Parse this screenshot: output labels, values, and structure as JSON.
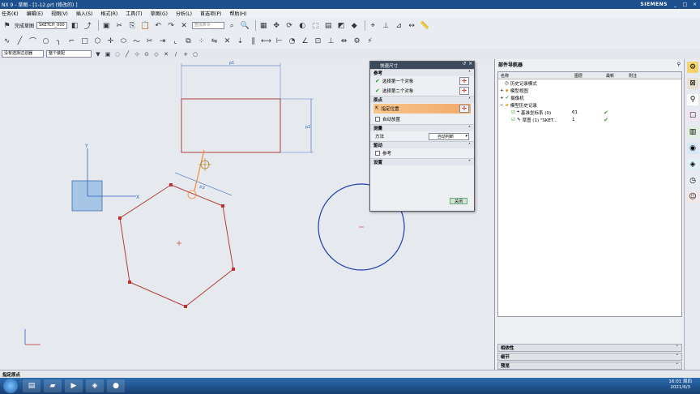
{
  "window": {
    "title": "NX 9 - 草图 - [1-12.prt (修改的) ]",
    "brand": "SIEMENS"
  },
  "menu": [
    "任务(K)",
    "编辑(E)",
    "视图(V)",
    "插入(S)",
    "格式(R)",
    "工具(T)",
    "草图(G)",
    "分析(L)",
    "首选项(P)",
    "帮助(H)"
  ],
  "toolbar": {
    "finish_sketch": "完成草图",
    "sketch_name": "SKETCH_000",
    "search_placeholder": "查找命令"
  },
  "filter": {
    "selection_filter": "没有选择过滤器",
    "scope": "整个装配"
  },
  "dialog": {
    "title": "快速尺寸",
    "sections": {
      "reference": "参考",
      "origin": "原点",
      "measure": "测量",
      "drive": "驱动",
      "settings": "设置"
    },
    "rows": {
      "first_object": "选择第一个对象",
      "second_object": "选择第二个对象",
      "specify_location": "指定位置",
      "auto_placement": "自动放置",
      "method_label": "方法",
      "method_value": "自动判断",
      "reference_chk": "参考"
    },
    "close": "关闭"
  },
  "navigator": {
    "title": "部件导航器",
    "columns": [
      "名称",
      "图层",
      "最新",
      "附注"
    ],
    "items": [
      {
        "name": "历史记录模式",
        "layer": "",
        "latest": ""
      },
      {
        "name": "模型视图",
        "layer": "",
        "latest": ""
      },
      {
        "name": "摄像机",
        "layer": "",
        "latest": ""
      },
      {
        "name": "模型历史记录",
        "layer": "",
        "latest": ""
      },
      {
        "name": "基准坐标系 (0)",
        "layer": "61",
        "latest": "✔"
      },
      {
        "name": "草图 (1) \"SKET...",
        "layer": "1",
        "latest": "✔"
      }
    ],
    "lower_panels": [
      "相依性",
      "细节",
      "预览"
    ]
  },
  "canvas": {
    "dim_labels": {
      "top": "p1",
      "right": "p2",
      "slant": "p3"
    },
    "axes": {
      "x": "X",
      "y": "Y"
    }
  },
  "status": {
    "prompt": "指定原点"
  },
  "clock": {
    "time": "16:01 周四",
    "date": "2021/6/3"
  },
  "colors": {
    "sketch_curve": "#b04040",
    "circle": "#1f3fb0",
    "dimension": "#3060c0",
    "highlight": "#f08a3c"
  }
}
